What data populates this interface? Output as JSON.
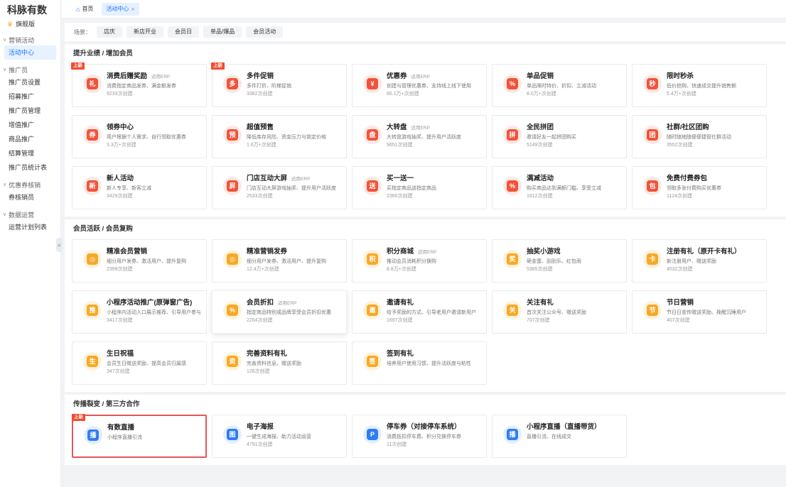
{
  "sidebar": {
    "logo": "科脉有数",
    "dashboard": "旗舰版",
    "groups": [
      {
        "label": "营销活动",
        "items": [
          {
            "label": "活动中心",
            "active": true
          }
        ]
      },
      {
        "label": "推广员",
        "items": [
          {
            "label": "推广员设置"
          },
          {
            "label": "招募推广"
          },
          {
            "label": "推广员管理"
          },
          {
            "label": "增值推广"
          },
          {
            "label": "商品推广"
          },
          {
            "label": "结算管理"
          },
          {
            "label": "推广员统计表"
          }
        ]
      },
      {
        "label": "优惠券核销",
        "items": [
          {
            "label": "券核销员"
          }
        ]
      },
      {
        "label": "数据运营",
        "items": [
          {
            "label": "运营计划列表"
          }
        ]
      }
    ],
    "collapse": "«"
  },
  "topbar": {
    "home": "首页",
    "active_tab": "活动中心",
    "close": "×"
  },
  "scene": {
    "label": "场景：",
    "chips": [
      "店庆",
      "新店开业",
      "会员日",
      "单品/爆品",
      "会员活动"
    ]
  },
  "colors": {
    "accent": "#1677ff",
    "red": "#f0533a",
    "yellow": "#f9a825",
    "blue": "#2f7df6"
  },
  "sections": [
    {
      "title": "提升业绩 / 增加会员",
      "cards": [
        {
          "title": "消费后赠奖励",
          "erp": "适用ERP",
          "desc": "消费指定商品发券、满金额发券",
          "count": "9233次创建",
          "badge": "上新",
          "color": "r",
          "icon": "gift-icon",
          "glyph": "礼"
        },
        {
          "title": "多件促销",
          "erp": "",
          "desc": "多件打折、阶梯促销",
          "count": "3382次创建",
          "badge": "上新",
          "color": "r",
          "icon": "bag-icon",
          "glyph": "多"
        },
        {
          "title": "优惠券",
          "erp": "适用ERP",
          "desc": "创建与管理优惠券、支持线上线下使用",
          "count": "66.1万+次创建",
          "badge": "",
          "color": "r",
          "icon": "coupon-icon",
          "glyph": "¥"
        },
        {
          "title": "单品促销",
          "erp": "",
          "desc": "单品限时特价、折扣、立减活动",
          "count": "8.0万+次创建",
          "badge": "",
          "color": "r",
          "icon": "percent-icon",
          "glyph": "%"
        },
        {
          "title": "限时秒杀",
          "erp": "",
          "desc": "低价抢购、快速成交提升销售额",
          "count": "5.4万+次创建",
          "badge": "",
          "color": "r",
          "icon": "lightning-icon",
          "glyph": "秒"
        },
        {
          "title": "领券中心",
          "erp": "",
          "desc": "用户根据个人需求、自行领取优惠券",
          "count": "3.3万+次创建",
          "badge": "",
          "color": "r",
          "icon": "ticket-center-icon",
          "glyph": "券"
        },
        {
          "title": "超值预售",
          "erp": "",
          "desc": "降低库存风险、资金压力与锁定价格",
          "count": "1.6万+次创建",
          "badge": "",
          "color": "r",
          "icon": "clock-icon",
          "glyph": "预"
        },
        {
          "title": "大转盘",
          "erp": "适用ERP",
          "desc": "大转盘游戏抽奖、提升用户活跃度",
          "count": "9651次创建",
          "badge": "",
          "color": "r",
          "icon": "wheel-icon",
          "glyph": "盘"
        },
        {
          "title": "全民拼团",
          "erp": "",
          "desc": "邀请好友一起拼团购买",
          "count": "5149次创建",
          "badge": "",
          "color": "r",
          "icon": "group-buy-icon",
          "glyph": "拼"
        },
        {
          "title": "社群/社区团购",
          "erp": "",
          "desc": "随时随地随便便捷管社群活动",
          "count": "3552次创建",
          "badge": "",
          "color": "r",
          "icon": "community-icon",
          "glyph": "团"
        },
        {
          "title": "新人活动",
          "erp": "",
          "desc": "新人专享、新客立减",
          "count": "3429次创建",
          "badge": "",
          "color": "r",
          "icon": "new-user-icon",
          "glyph": "新"
        },
        {
          "title": "门店互动大屏",
          "erp": "适用ERP",
          "desc": "门店互动大屏游戏抽奖、提升用户活跃度",
          "count": "2533次创建",
          "badge": "",
          "color": "r",
          "icon": "screen-icon",
          "glyph": "屏"
        },
        {
          "title": "买一送一",
          "erp": "",
          "desc": "买指定商品送指定商品",
          "count": "2360次创建",
          "badge": "",
          "color": "r",
          "icon": "buy-one-icon",
          "glyph": "送"
        },
        {
          "title": "满减活动",
          "erp": "",
          "desc": "购买商品达到满额门槛、享受立减",
          "count": "1612次创建",
          "badge": "",
          "color": "r",
          "icon": "discount-icon",
          "glyph": "%"
        },
        {
          "title": "免费付费券包",
          "erp": "",
          "desc": "领取多张付费购买优惠券",
          "count": "1124次创建",
          "badge": "",
          "color": "r",
          "icon": "coupon-pack-icon",
          "glyph": "包"
        }
      ]
    },
    {
      "title": "会员活跃 / 会员复购",
      "cards": [
        {
          "title": "精准会员营销",
          "erp": "",
          "desc": "细分用户发券、激活用户、提升复购",
          "count": "2399次创建",
          "badge": "",
          "color": "y",
          "icon": "target-icon",
          "glyph": "◎"
        },
        {
          "title": "精准营销发券",
          "erp": "",
          "desc": "细分用户发券、激活用户、提升复购",
          "count": "12.4万+次创建",
          "badge": "",
          "color": "y",
          "icon": "target-icon",
          "glyph": "◎"
        },
        {
          "title": "积分商城",
          "erp": "适用ERP",
          "desc": "推动会员消耗积分换购",
          "count": "8.8万+次创建",
          "badge": "",
          "color": "y",
          "icon": "coins-icon",
          "glyph": "积"
        },
        {
          "title": "抽奖小游戏",
          "erp": "",
          "desc": "砸金蛋、刮刮乐、红包雨",
          "count": "5365次创建",
          "badge": "",
          "color": "y",
          "icon": "lottery-icon",
          "glyph": "奖"
        },
        {
          "title": "注册有礼（原开卡有礼）",
          "erp": "",
          "desc": "新注册用户、赠送奖励",
          "count": "4532次创建",
          "badge": "",
          "color": "y",
          "icon": "card-icon",
          "glyph": "卡"
        },
        {
          "title": "小程序活动推广(原弹窗广告)",
          "erp": "",
          "desc": "小程序内活动入口展示推荐、引导用户参与",
          "count": "3417次创建",
          "badge": "",
          "color": "y",
          "icon": "miniapp-icon",
          "glyph": "推"
        },
        {
          "title": "会员折扣",
          "erp": "适用ERP",
          "desc": "指定商品特别或品牌享受会员折扣优惠",
          "count": "2204次创建",
          "badge": "",
          "color": "y",
          "icon": "tag-icon",
          "glyph": "%",
          "shadow": true
        },
        {
          "title": "邀请有礼",
          "erp": "",
          "desc": "给予奖励的方式、引导老用户邀请新用户",
          "count": "1697次创建",
          "badge": "",
          "color": "y",
          "icon": "invite-gift-icon",
          "glyph": "邀"
        },
        {
          "title": "关注有礼",
          "erp": "",
          "desc": "首次关注公众号、赠送奖励",
          "count": "707次创建",
          "badge": "",
          "color": "y",
          "icon": "follow-gift-icon",
          "glyph": "关"
        },
        {
          "title": "节日营销",
          "erp": "",
          "desc": "节日日宣传赠送奖励、挽醒沉睡用户",
          "count": "407次创建",
          "badge": "",
          "color": "y",
          "icon": "calendar-icon",
          "glyph": "节"
        },
        {
          "title": "生日祝福",
          "erp": "",
          "desc": "会员生日赠送奖励、提高会员归属感",
          "count": "347次创建",
          "badge": "",
          "color": "y",
          "icon": "cake-icon",
          "glyph": "生"
        },
        {
          "title": "完善资料有礼",
          "erp": "",
          "desc": "完善资料信息、赠送奖励",
          "count": "126次创建",
          "badge": "",
          "color": "y",
          "icon": "form-icon",
          "glyph": "资"
        },
        {
          "title": "签到有礼",
          "erp": "",
          "desc": "培养用户使用习惯、提升活跃度与粘性",
          "count": "",
          "badge": "",
          "color": "y",
          "icon": "checkin-icon",
          "glyph": "签"
        }
      ]
    },
    {
      "title": "传播裂变 / 第三方合作",
      "cards": [
        {
          "title": "有数直播",
          "erp": "",
          "desc": "小程序直播引流",
          "count": "",
          "badge": "上新",
          "color": "b",
          "icon": "live-cart-icon",
          "glyph": "播",
          "hl": true
        },
        {
          "title": "电子海报",
          "erp": "",
          "desc": "一键生成海报、助力活动运营",
          "count": "4791次创建",
          "badge": "",
          "color": "b",
          "icon": "poster-icon",
          "glyph": "图"
        },
        {
          "title": "停车券（对接停车系统）",
          "erp": "",
          "desc": "消费抵扣停车费、积分兑换停车券",
          "count": "11次创建",
          "badge": "",
          "color": "b",
          "icon": "parking-icon",
          "glyph": "P"
        },
        {
          "title": "小程序直播（直播带货）",
          "erp": "",
          "desc": "直播引流、在线成交",
          "count": "",
          "badge": "",
          "color": "b",
          "icon": "live-cart-icon",
          "glyph": "播"
        }
      ]
    }
  ]
}
